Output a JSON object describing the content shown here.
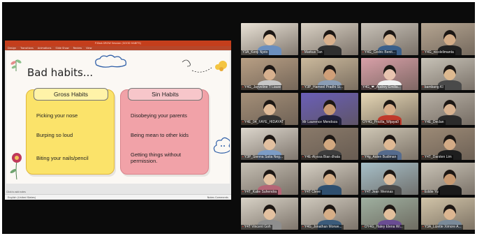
{
  "ppt": {
    "window_title": "P-Bad-GROW Session (GOOD HABITS)",
    "menu": [
      "Design",
      "Transitions",
      "Animations",
      "Slide Show",
      "Review",
      "View"
    ],
    "notes": "Click to add notes",
    "status_left": "English (United States)",
    "status_right": "Notes   Comments"
  },
  "slide": {
    "title": "Bad habits...",
    "gross": {
      "heading": "Gross Habits",
      "items": [
        "Picking your nose",
        "Burping so loud",
        "Biting your nails/pencil"
      ]
    },
    "sin": {
      "heading": "Sin Habits",
      "items": [
        "Disobeying your parents",
        "Being mean to other kids",
        "Getting things without permission."
      ]
    }
  },
  "gallery": {
    "tiles": [
      {
        "name": "Y3A_Kenji Njoto",
        "muted": false,
        "bg": "#e9e2d6",
        "skin": "#e8c9a8",
        "shirt": "#6b8fbf"
      },
      {
        "name": "Markus Tan",
        "muted": true,
        "bg": "#d9d1c4",
        "skin": "#d9b08c",
        "shirt": "#2f2f2f"
      },
      {
        "name": "Y4G_Cedric Benit...",
        "muted": true,
        "bg": "#c8c2b8",
        "skin": "#d8b896",
        "shirt": "#3a5f8a"
      },
      {
        "name": "Y4G_nicolelimanta",
        "muted": true,
        "bg": "#b5a591",
        "skin": "#d4ad88",
        "shirt": "#222222"
      },
      {
        "name": "Y4G_Jayveline T Liauw",
        "muted": true,
        "bg": "#b89f84",
        "skin": "#d6b08e",
        "shirt": "#c7c7c7"
      },
      {
        "name": "Y3P_Hameel Pradhi Si...",
        "muted": true,
        "bg": "#cbb99c",
        "skin": "#cf9f78",
        "shirt": "#8a9db5"
      },
      {
        "name": "Y4G_❤_Audrey Emilia...",
        "muted": false,
        "bg": "#d8a0a8",
        "skin": "#e8c4b0",
        "shirt": "#f2f2f2"
      },
      {
        "name": "bambang KI",
        "muted": true,
        "bg": "#c7c2b7",
        "skin": "#ddb990",
        "shirt": "#4a4a4a"
      },
      {
        "name": "Y4E_04_FAYE_HIDAYAT",
        "muted": true,
        "bg": "#a48f78",
        "skin": "#e0bb98",
        "shirt": "#333333"
      },
      {
        "name": "Mr Laurence Mendoza",
        "muted": false,
        "bg": "#6a5fb8",
        "skin": "#c99a73",
        "shirt": "#1f1f3a"
      },
      {
        "name": "OY4G_Pricilla_Wijaya0",
        "muted": false,
        "bg": "#e6d7b5",
        "skin": "#d8ae8a",
        "shirt": "#c0392b"
      },
      {
        "name": "Y4E_Declan",
        "muted": true,
        "bg": "#b7b0a5",
        "skin": "#d9b391",
        "shirt": "#2b2b2b"
      },
      {
        "name": "Y3P_Sienna Satia Neg...",
        "muted": true,
        "bg": "#dcd6cc",
        "skin": "#e2c0a0",
        "shirt": "#7c9cc6"
      },
      {
        "name": "Y4E-Alyssa Bian dhata",
        "muted": true,
        "bg": "#8a7a6a",
        "skin": "#d2a880",
        "shirt": "#3d3d3d"
      },
      {
        "name": "Y4g_Aiden Budiman",
        "muted": true,
        "bg": "#cfc7b5",
        "skin": "#dfb994",
        "shirt": "#556b8d"
      },
      {
        "name": "Y4T_Darsten Lim",
        "muted": true,
        "bg": "#9c8a76",
        "skin": "#d3ab86",
        "shirt": "#1e1e1e"
      },
      {
        "name": "Y4T_Katie Suhendra",
        "muted": true,
        "bg": "#c5bfb3",
        "skin": "#e4c3a2",
        "shirt": "#b56576"
      },
      {
        "name": "Y4T Cleve",
        "muted": true,
        "bg": "#d6d0c4",
        "skin": "#d5ae88",
        "shirt": "#2f4f6f"
      },
      {
        "name": "Y4T Jean Wennas",
        "muted": true,
        "bg": "#a7c0c9",
        "skin": "#e1bf9d",
        "shirt": "#4b4b4b"
      },
      {
        "name": "Eddie Yu",
        "muted": true,
        "bg": "#c9c3b6",
        "skin": "#c89a72",
        "shirt": "#1a1a1a"
      },
      {
        "name": "Y4T Vincent Goh",
        "muted": true,
        "bg": "#d8d2c6",
        "skin": "#e3c1a0",
        "shirt": "#8e8e8e"
      },
      {
        "name": "Y4G_Jonathan Morwe...",
        "muted": true,
        "bg": "#cfc9bd",
        "skin": "#d6ae87",
        "shirt": "#3b5b7a"
      },
      {
        "name": "OY4G_Haley Elena Wi...",
        "muted": true,
        "bg": "#9fb0a0",
        "skin": "#e2bf9c",
        "shirt": "#6a4c93"
      },
      {
        "name": "Y3A_Lizette Ximore A...",
        "muted": true,
        "bg": "#d1c4a8",
        "skin": "#dcb691",
        "shirt": "#7a8a99"
      }
    ]
  }
}
